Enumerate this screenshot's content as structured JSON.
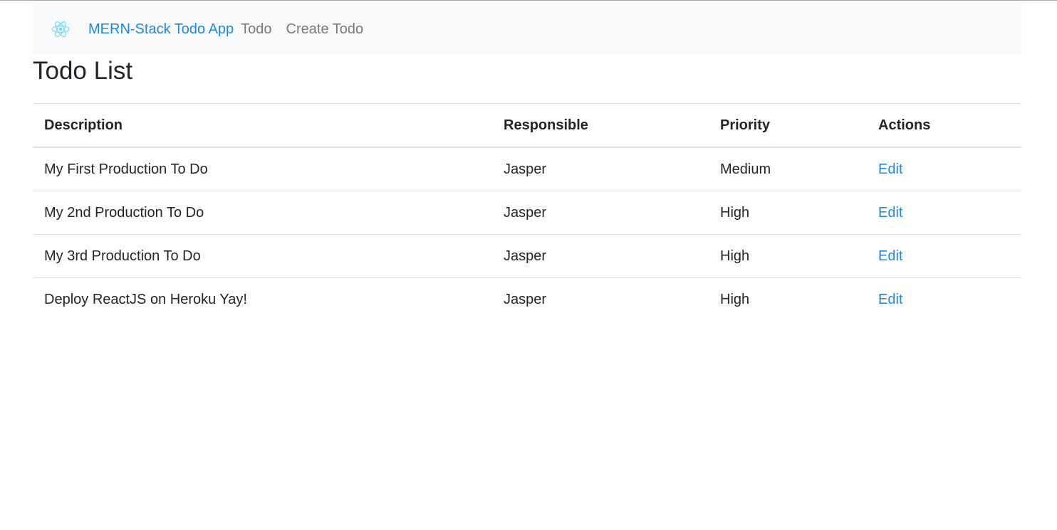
{
  "navbar": {
    "logo_icon": "react-logo-icon",
    "brand": "MERN-Stack Todo App",
    "links": [
      "Todo",
      "Create Todo"
    ]
  },
  "page": {
    "title": "Todo List"
  },
  "table": {
    "headers": [
      "Description",
      "Responsible",
      "Priority",
      "Actions"
    ],
    "rows": [
      {
        "description": "My First Production To Do",
        "responsible": "Jasper",
        "priority": "Medium",
        "action": "Edit"
      },
      {
        "description": "My 2nd Production To Do",
        "responsible": "Jasper",
        "priority": "High",
        "action": "Edit"
      },
      {
        "description": "My 3rd Production To Do",
        "responsible": "Jasper",
        "priority": "High",
        "action": "Edit"
      },
      {
        "description": "Deploy ReactJS on Heroku Yay!",
        "responsible": "Jasper",
        "priority": "High",
        "action": "Edit"
      }
    ]
  },
  "colors": {
    "link": "#1e88e5",
    "nav_bg": "#f8f9fa",
    "react_logo": "#61dafb"
  }
}
